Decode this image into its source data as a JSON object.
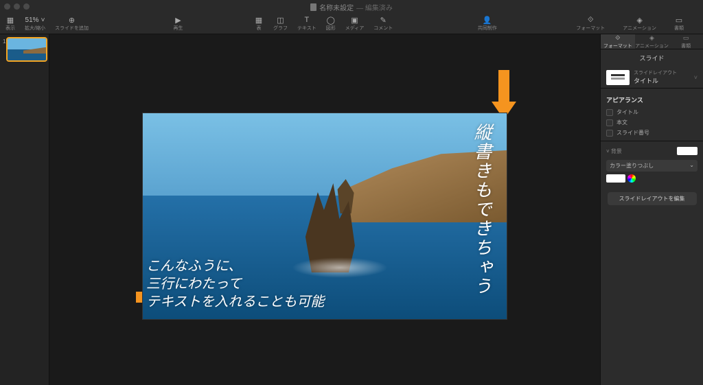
{
  "titlebar": {
    "doc_name": "名称未設定",
    "edited": "編集済み"
  },
  "toolbar": {
    "view": "表示",
    "zoom_label": "拡大/縮小",
    "zoom_value": "51%",
    "add_slide": "スライドを追加",
    "play": "再生",
    "table": "表",
    "chart": "グラフ",
    "text": "テキスト",
    "shape": "図形",
    "media": "メディア",
    "comment": "コメント",
    "collab": "共同制作",
    "format": "フォーマット",
    "animate": "アニメーション",
    "document": "書類"
  },
  "thumbs": {
    "n1": "1"
  },
  "slide": {
    "horizontal_l1": "こんなふうに、",
    "horizontal_l2": "三行にわたって",
    "horizontal_l3": "テキストを入れることも可能",
    "vertical": "縦書きもできちゃう"
  },
  "inspector": {
    "tab_format": "フォーマット",
    "tab_animate": "アニメーション",
    "tab_document": "書類",
    "panel_title": "スライド",
    "layout_label": "スライドレイアウト",
    "layout_name": "タイトル",
    "appearance": "アピアランス",
    "chk_title": "タイトル",
    "chk_body": "本文",
    "chk_number": "スライド番号",
    "background": "背景",
    "fill_type": "カラー塗りつぶし",
    "edit_layout": "スライドレイアウトを編集"
  }
}
